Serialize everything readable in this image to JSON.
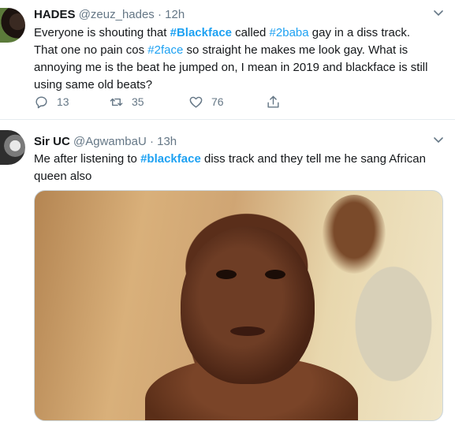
{
  "tweets": [
    {
      "display_name": "HADES",
      "handle": "@zeuz_hades",
      "separator": "·",
      "time": "12h",
      "text_segments": [
        {
          "text": "Everyone is shouting that ",
          "type": "plain"
        },
        {
          "text": "#Blackface",
          "type": "hashtag-bold"
        },
        {
          "text": " called ",
          "type": "plain"
        },
        {
          "text": "#2baba",
          "type": "hashtag"
        },
        {
          "text": " gay in a diss track. That one no pain cos ",
          "type": "plain"
        },
        {
          "text": "#2face",
          "type": "hashtag"
        },
        {
          "text": " so straight he makes me look gay. What is annoying me is the beat he jumped on, I mean in 2019 and blackface is still using same old beats?",
          "type": "plain"
        }
      ],
      "replies": "13",
      "retweets": "35",
      "likes": "76"
    },
    {
      "display_name": "Sir UC",
      "handle": "@AgwambaU",
      "separator": "·",
      "time": "13h",
      "text_segments": [
        {
          "text": "Me after listening to ",
          "type": "plain"
        },
        {
          "text": "#blackface",
          "type": "hashtag-bold"
        },
        {
          "text": " diss track and they tell me he sang African queen also",
          "type": "plain"
        }
      ]
    }
  ],
  "icons": {
    "reply": "reply-icon",
    "retweet": "retweet-icon",
    "like": "heart-icon",
    "share": "share-icon",
    "caret": "chevron-down-icon"
  },
  "colors": {
    "hashtag": "#1da1f2",
    "secondary_text": "#657786",
    "primary_text": "#14171a",
    "divider": "#e6ecf0"
  }
}
